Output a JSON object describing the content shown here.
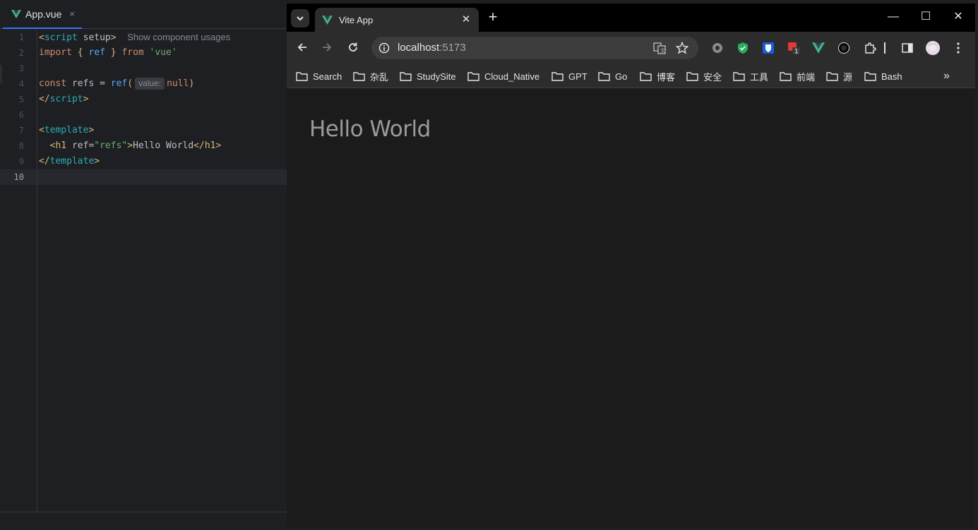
{
  "ide": {
    "tab": {
      "filename": "App.vue",
      "close": "×"
    },
    "line_numbers": [
      "1",
      "2",
      "3",
      "4",
      "5",
      "6",
      "7",
      "8",
      "9",
      "10"
    ],
    "hints": {
      "component_usages": "Show component usages",
      "param_value": "value:"
    },
    "code": {
      "l1_open": "<",
      "l1_tag": "script",
      "l1_attr": " setup",
      "l1_close": ">",
      "l2_import": "import",
      "l2_brace_open": " { ",
      "l2_ref": "ref",
      "l2_brace_close": " } ",
      "l2_from": "from",
      "l2_str": " 'vue'",
      "l4_const": "const",
      "l4_name": " refs = ",
      "l4_fn": "ref",
      "l4_paren": "(",
      "l4_null": "null",
      "l4_end": ")",
      "l5_open": "</",
      "l5_tag": "script",
      "l5_close": ">",
      "l7_open": "<",
      "l7_tag": "template",
      "l7_close": ">",
      "l8_indent": "  ",
      "l8_open": "<",
      "l8_tag": "h1",
      "l8_attr": " ref=",
      "l8_val": "\"refs\"",
      "l8_gt": ">",
      "l8_text": "Hello World",
      "l8_close_open": "</",
      "l8_close_tag": "h1",
      "l8_close_gt": ">",
      "l9_open": "</",
      "l9_tag": "template",
      "l9_close": ">"
    }
  },
  "browser": {
    "tab_title": "Vite App",
    "tab_close": "✕",
    "new_tab": "+",
    "window": {
      "minimize": "—",
      "maximize": "☐",
      "close": "✕"
    },
    "url": {
      "host": "localhost",
      "port": ":5173"
    },
    "bookmarks": [
      "Search",
      "杂乱",
      "StudySite",
      "Cloud_Native",
      "GPT",
      "Go",
      "博客",
      "安全",
      "工具",
      "前端",
      "源",
      "Bash"
    ],
    "bookmarks_more": "»",
    "extension_badge": "1",
    "page": {
      "heading": "Hello World"
    }
  },
  "colors": {
    "vue_green": "#41b883",
    "accent_blue": "#3574f0"
  }
}
